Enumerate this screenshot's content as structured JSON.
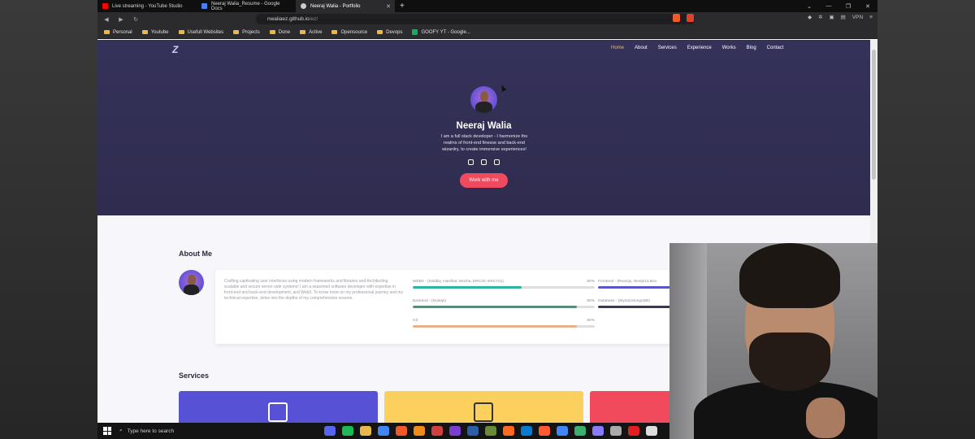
{
  "tabs": [
    {
      "label": "Live streaming - YouTube Studio",
      "color": "#ff0000"
    },
    {
      "label": "Neeraj Walia_Resume - Google Docs",
      "color": "#4a7ff0"
    },
    {
      "label": "Neeraj Walia - Portfolio",
      "color": "#cccccc"
    }
  ],
  "address": {
    "host": "nwaliaez.github.io",
    "path": "/ez/"
  },
  "addr_right": {
    "vpn": "VPN"
  },
  "bookmarks": [
    "Personal",
    "Youtube",
    "Usefull Websites",
    "Projects",
    "Done",
    "Active",
    "Opensource",
    "Devops",
    "GOOFY YT - Google..."
  ],
  "site": {
    "logo": "Z",
    "nav": [
      "Home",
      "About",
      "Services",
      "Experience",
      "Works",
      "Blog",
      "Contact"
    ],
    "name": "Neeraj Walia",
    "tagline": "I am a full stack developer - I harmonize the realms of front-end finesse and back-end wizardry, to create immersive experiences!",
    "cta": "Work with me",
    "about_title": "About Me",
    "about_text": "Crafting captivating user interfaces using modern frameworks and libraries and Architecting scalable and secure server-side systems! I am a seasoned software developer with expertise in front-end and back-end development, and Web3. To know more on my professional journey and my technical expertise, delve into the depths of my comprehensive resume.",
    "skills": [
      {
        "name": "WEB3 - (Solidity, Hardhat, Mocha, ERC20, ERC721)",
        "pct": "60%",
        "value": 0.6,
        "color": "#2bb5a0"
      },
      {
        "name": "Frontend - (Reactjs, Nextjs13,Boo",
        "pct": "",
        "value": 1.0,
        "color": "#5a55c8"
      },
      {
        "name": "Backend - (Nodejs)",
        "pct": "90%",
        "value": 0.9,
        "color": "#5a8a78"
      },
      {
        "name": "Database - (MySql,MongoDB)",
        "pct": "",
        "value": 1.0,
        "color": "#3a3a4a"
      },
      {
        "name": "Git",
        "pct": "90%",
        "value": 0.9,
        "color": "#e8b089"
      }
    ],
    "services_title": "Services",
    "service_colors": [
      "#5751d6",
      "#fcd05c",
      "#f04a5c"
    ]
  },
  "taskbar": {
    "search_placeholder": "Type here to search"
  }
}
